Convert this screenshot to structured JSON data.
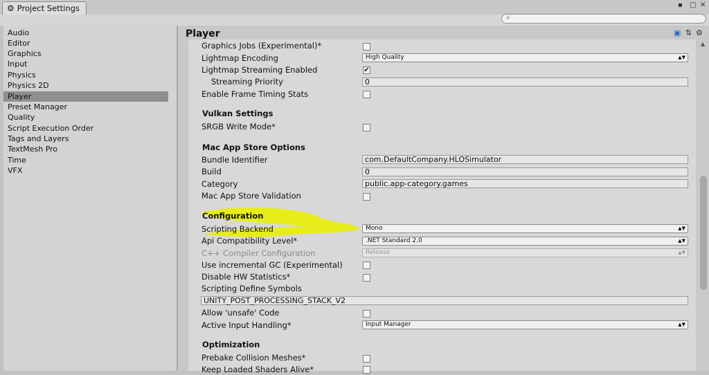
{
  "window": {
    "title": "Project Settings",
    "tab_icon": "gear-icon",
    "controls": [
      "menu-icon",
      "maximize-icon",
      "close-icon"
    ]
  },
  "search": {
    "placeholder": "",
    "icon": "search-icon"
  },
  "sidebar": {
    "items": [
      {
        "label": "Audio"
      },
      {
        "label": "Editor"
      },
      {
        "label": "Graphics"
      },
      {
        "label": "Input"
      },
      {
        "label": "Physics"
      },
      {
        "label": "Physics 2D"
      },
      {
        "label": "Player",
        "selected": true
      },
      {
        "label": "Preset Manager"
      },
      {
        "label": "Quality"
      },
      {
        "label": "Script Execution Order"
      },
      {
        "label": "Tags and Layers"
      },
      {
        "label": "TextMesh Pro"
      },
      {
        "label": "Time"
      },
      {
        "label": "VFX"
      }
    ]
  },
  "header": {
    "title": "Player",
    "icons": [
      "help-icon",
      "preset-icon",
      "settings-icon"
    ]
  },
  "rows": {
    "graphics_jobs": {
      "label": "Graphics Jobs (Experimental)*",
      "checked": false
    },
    "lightmap_encoding": {
      "label": "Lightmap Encoding",
      "value": "High Quality"
    },
    "lightmap_streaming": {
      "label": "Lightmap Streaming Enabled",
      "checked": true
    },
    "streaming_priority": {
      "label": "Streaming Priority",
      "value": "0"
    },
    "frame_timing": {
      "label": "Enable Frame Timing Stats",
      "checked": false
    },
    "vulkan_section": "Vulkan Settings",
    "srgb_write": {
      "label": "SRGB Write Mode*",
      "checked": false
    },
    "mac_section": "Mac App Store Options",
    "bundle_id": {
      "label": "Bundle Identifier",
      "value": "com.DefaultCompany.HLOSimulator"
    },
    "build": {
      "label": "Build",
      "value": "0"
    },
    "category": {
      "label": "Category",
      "value": "public.app-category.games"
    },
    "mac_validation": {
      "label": "Mac App Store Validation",
      "checked": false
    },
    "config_section": "Configuration",
    "scripting_backend": {
      "label": "Scripting Backend",
      "value": "Mono"
    },
    "api_level": {
      "label": "Api Compatibility Level*",
      "value": ".NET Standard 2.0"
    },
    "cpp_config": {
      "label": "C++ Compiler Configuration",
      "value": "Release"
    },
    "incremental_gc": {
      "label": "Use incremental GC (Experimental)",
      "checked": false
    },
    "hw_stats": {
      "label": "Disable HW Statistics*",
      "checked": false
    },
    "define_symbols": {
      "label": "Scripting Define Symbols",
      "value": "UNITY_POST_PROCESSING_STACK_V2"
    },
    "unsafe_code": {
      "label": "Allow 'unsafe' Code",
      "checked": false
    },
    "input_handling": {
      "label": "Active Input Handling*",
      "value": "Input Manager"
    },
    "opt_section": "Optimization",
    "prebake": {
      "label": "Prebake Collision Meshes*",
      "checked": false
    },
    "keep_shaders": {
      "label": "Keep Loaded Shaders Alive*",
      "checked": false
    }
  },
  "colors": {
    "highlight": "#e8ee10",
    "selected_item": "#8f8f8f"
  }
}
